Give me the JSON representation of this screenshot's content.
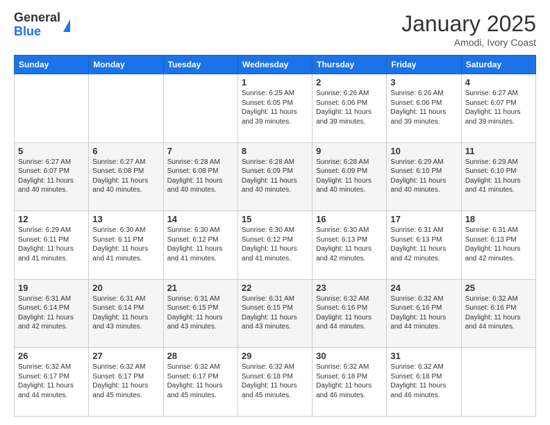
{
  "header": {
    "logo_general": "General",
    "logo_blue": "Blue",
    "title": "January 2025",
    "subtitle": "Amodi, Ivory Coast"
  },
  "calendar": {
    "days": [
      "Sunday",
      "Monday",
      "Tuesday",
      "Wednesday",
      "Thursday",
      "Friday",
      "Saturday"
    ],
    "weeks": [
      [
        {
          "num": "",
          "info": ""
        },
        {
          "num": "",
          "info": ""
        },
        {
          "num": "",
          "info": ""
        },
        {
          "num": "1",
          "info": "Sunrise: 6:25 AM\nSunset: 6:05 PM\nDaylight: 11 hours and 39 minutes."
        },
        {
          "num": "2",
          "info": "Sunrise: 6:26 AM\nSunset: 6:06 PM\nDaylight: 11 hours and 39 minutes."
        },
        {
          "num": "3",
          "info": "Sunrise: 6:26 AM\nSunset: 6:06 PM\nDaylight: 11 hours and 39 minutes."
        },
        {
          "num": "4",
          "info": "Sunrise: 6:27 AM\nSunset: 6:07 PM\nDaylight: 11 hours and 39 minutes."
        }
      ],
      [
        {
          "num": "5",
          "info": "Sunrise: 6:27 AM\nSunset: 6:07 PM\nDaylight: 11 hours and 40 minutes."
        },
        {
          "num": "6",
          "info": "Sunrise: 6:27 AM\nSunset: 6:08 PM\nDaylight: 11 hours and 40 minutes."
        },
        {
          "num": "7",
          "info": "Sunrise: 6:28 AM\nSunset: 6:08 PM\nDaylight: 11 hours and 40 minutes."
        },
        {
          "num": "8",
          "info": "Sunrise: 6:28 AM\nSunset: 6:09 PM\nDaylight: 11 hours and 40 minutes."
        },
        {
          "num": "9",
          "info": "Sunrise: 6:28 AM\nSunset: 6:09 PM\nDaylight: 11 hours and 40 minutes."
        },
        {
          "num": "10",
          "info": "Sunrise: 6:29 AM\nSunset: 6:10 PM\nDaylight: 11 hours and 40 minutes."
        },
        {
          "num": "11",
          "info": "Sunrise: 6:29 AM\nSunset: 6:10 PM\nDaylight: 11 hours and 41 minutes."
        }
      ],
      [
        {
          "num": "12",
          "info": "Sunrise: 6:29 AM\nSunset: 6:11 PM\nDaylight: 11 hours and 41 minutes."
        },
        {
          "num": "13",
          "info": "Sunrise: 6:30 AM\nSunset: 6:11 PM\nDaylight: 11 hours and 41 minutes."
        },
        {
          "num": "14",
          "info": "Sunrise: 6:30 AM\nSunset: 6:12 PM\nDaylight: 11 hours and 41 minutes."
        },
        {
          "num": "15",
          "info": "Sunrise: 6:30 AM\nSunset: 6:12 PM\nDaylight: 11 hours and 41 minutes."
        },
        {
          "num": "16",
          "info": "Sunrise: 6:30 AM\nSunset: 6:13 PM\nDaylight: 11 hours and 42 minutes."
        },
        {
          "num": "17",
          "info": "Sunrise: 6:31 AM\nSunset: 6:13 PM\nDaylight: 11 hours and 42 minutes."
        },
        {
          "num": "18",
          "info": "Sunrise: 6:31 AM\nSunset: 6:13 PM\nDaylight: 11 hours and 42 minutes."
        }
      ],
      [
        {
          "num": "19",
          "info": "Sunrise: 6:31 AM\nSunset: 6:14 PM\nDaylight: 11 hours and 42 minutes."
        },
        {
          "num": "20",
          "info": "Sunrise: 6:31 AM\nSunset: 6:14 PM\nDaylight: 11 hours and 43 minutes."
        },
        {
          "num": "21",
          "info": "Sunrise: 6:31 AM\nSunset: 6:15 PM\nDaylight: 11 hours and 43 minutes."
        },
        {
          "num": "22",
          "info": "Sunrise: 6:31 AM\nSunset: 6:15 PM\nDaylight: 11 hours and 43 minutes."
        },
        {
          "num": "23",
          "info": "Sunrise: 6:32 AM\nSunset: 6:16 PM\nDaylight: 11 hours and 44 minutes."
        },
        {
          "num": "24",
          "info": "Sunrise: 6:32 AM\nSunset: 6:16 PM\nDaylight: 11 hours and 44 minutes."
        },
        {
          "num": "25",
          "info": "Sunrise: 6:32 AM\nSunset: 6:16 PM\nDaylight: 11 hours and 44 minutes."
        }
      ],
      [
        {
          "num": "26",
          "info": "Sunrise: 6:32 AM\nSunset: 6:17 PM\nDaylight: 11 hours and 44 minutes."
        },
        {
          "num": "27",
          "info": "Sunrise: 6:32 AM\nSunset: 6:17 PM\nDaylight: 11 hours and 45 minutes."
        },
        {
          "num": "28",
          "info": "Sunrise: 6:32 AM\nSunset: 6:17 PM\nDaylight: 11 hours and 45 minutes."
        },
        {
          "num": "29",
          "info": "Sunrise: 6:32 AM\nSunset: 6:18 PM\nDaylight: 11 hours and 45 minutes."
        },
        {
          "num": "30",
          "info": "Sunrise: 6:32 AM\nSunset: 6:18 PM\nDaylight: 11 hours and 46 minutes."
        },
        {
          "num": "31",
          "info": "Sunrise: 6:32 AM\nSunset: 6:18 PM\nDaylight: 11 hours and 46 minutes."
        },
        {
          "num": "",
          "info": ""
        }
      ]
    ]
  }
}
